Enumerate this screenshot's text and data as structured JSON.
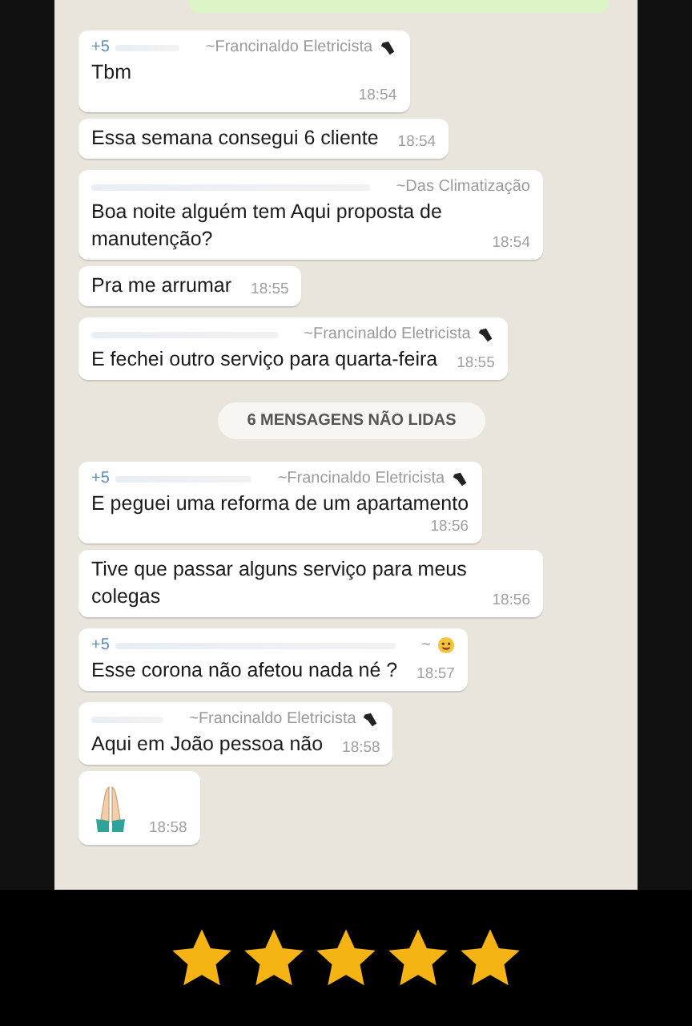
{
  "messages": [
    {
      "kind": "text",
      "phone": "+5",
      "sender": "~Francinaldo Eletricista",
      "has_tool_icon": true,
      "text": "Tbm",
      "time": "18:54",
      "time_below": true
    },
    {
      "kind": "text",
      "text": "Essa semana consegui 6 cliente",
      "time": "18:54",
      "time_below": false
    },
    {
      "kind": "text",
      "sender": "~Das Climatização",
      "text": "Boa noite alguém tem Aqui proposta de manutenção?",
      "time": "18:54",
      "time_below": false
    },
    {
      "kind": "text",
      "text": "Pra me arrumar",
      "time": "18:55",
      "time_below": false
    },
    {
      "kind": "text",
      "sender": "~Francinaldo Eletricista",
      "has_tool_icon": true,
      "text": "E fechei outro serviço para quarta-feira",
      "time": "18:55",
      "time_below": false
    },
    {
      "kind": "divider",
      "text": "6 MENSAGENS NÃO LIDAS"
    },
    {
      "kind": "text",
      "phone": "+5",
      "sender": "~Francinaldo Eletricista",
      "has_tool_icon": true,
      "text": "E peguei uma reforma de um apartamento",
      "time": "18:56",
      "time_below": true
    },
    {
      "kind": "text",
      "text": "Tive que passar alguns serviço para meus colegas",
      "time": "18:56",
      "time_below": false
    },
    {
      "kind": "text",
      "phone": "+5",
      "sender": "~",
      "has_emoji_icon": true,
      "text": "Esse corona não afetou nada né ?",
      "time": "18:57",
      "time_below": false
    },
    {
      "kind": "text",
      "sender": "~Francinaldo Eletricista",
      "has_tool_icon": true,
      "text": "Aqui em João pessoa não",
      "time": "18:58",
      "time_below": false
    },
    {
      "kind": "emoji",
      "time": "18:58"
    }
  ],
  "rating": {
    "stars": 5
  }
}
